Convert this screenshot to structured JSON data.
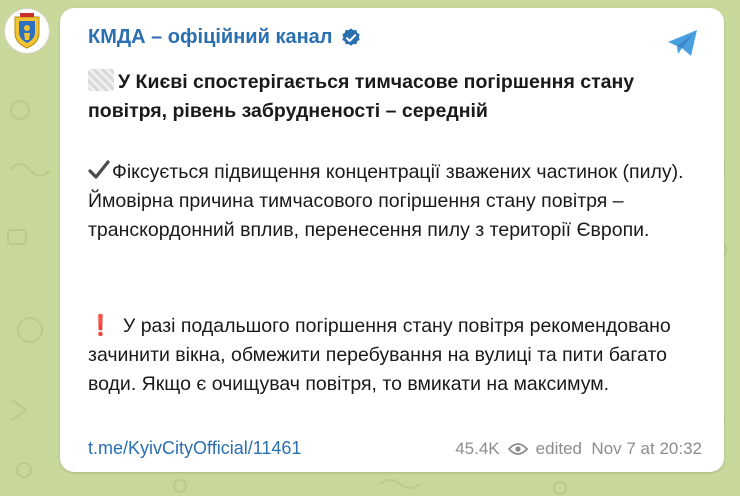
{
  "channel": {
    "name": "КМДА – офіційний канал"
  },
  "message": {
    "headline": "У Києві спостерігається тимчасове погіршення стану повітря, рівень забрудненості – середній",
    "paragraph1": "Фіксується підвищення концентрації зважених частинок (пилу). Ймовірна причина тимчасового погіршення стану повітря – транскордонний вплив, перенесення пилу з території Європи.",
    "paragraph2_marker": "❗",
    "paragraph2": "У разі подальшого погіршення стану повітря рекомендовано зачинити вікна, обмежити перебування на вулиці та пити багато води. Якщо є очищувач повітря, то вмикати на максимум."
  },
  "footer": {
    "link": "t.me/KyivCityOfficial/11461",
    "views": "45.4K",
    "edited": "edited  Nov 7 at 20:32"
  },
  "icons": {
    "avatar": "kyiv-coat-of-arms-icon",
    "verified": "verified-badge-icon",
    "share": "telegram-share-icon",
    "check": "check-mark-icon",
    "views": "eye-icon"
  },
  "colors": {
    "background": "#c8d79a",
    "accent": "#2a6fb0",
    "share": "#4a9fe0",
    "alert": "#e0162b",
    "muted": "#8c8c8c"
  }
}
